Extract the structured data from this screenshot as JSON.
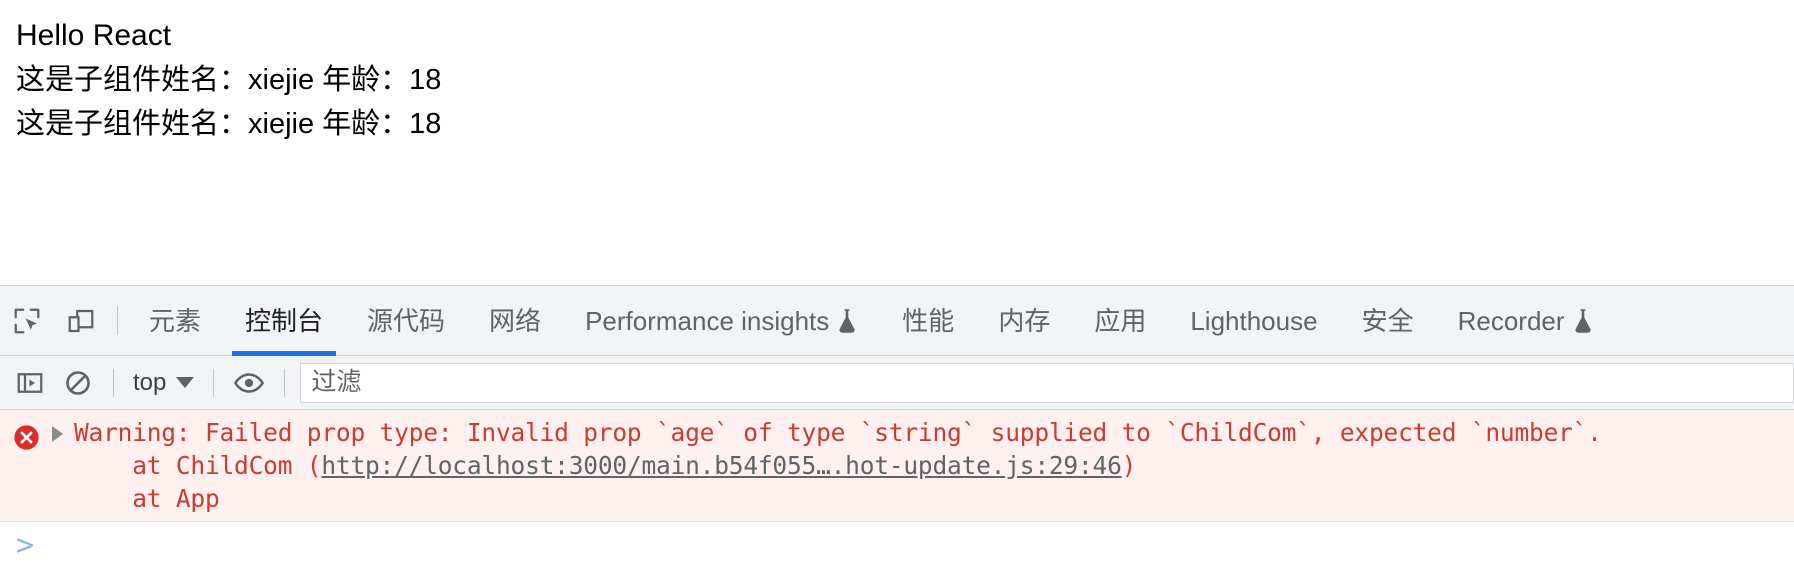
{
  "page": {
    "lines": [
      "Hello React",
      "这是子组件姓名：xiejie 年龄：18",
      "这是子组件姓名：xiejie 年龄：18"
    ]
  },
  "devtools": {
    "toolbar_icons": {
      "inspect": "inspect-element-icon",
      "device": "device-toolbar-icon"
    },
    "tabs": [
      {
        "label": "元素",
        "active": false,
        "experimental": false
      },
      {
        "label": "控制台",
        "active": true,
        "experimental": false
      },
      {
        "label": "源代码",
        "active": false,
        "experimental": false
      },
      {
        "label": "网络",
        "active": false,
        "experimental": false
      },
      {
        "label": "Performance insights",
        "active": false,
        "experimental": true
      },
      {
        "label": "性能",
        "active": false,
        "experimental": false
      },
      {
        "label": "内存",
        "active": false,
        "experimental": false
      },
      {
        "label": "应用",
        "active": false,
        "experimental": false
      },
      {
        "label": "Lighthouse",
        "active": false,
        "experimental": false
      },
      {
        "label": "安全",
        "active": false,
        "experimental": false
      },
      {
        "label": "Recorder",
        "active": false,
        "experimental": true
      }
    ],
    "active_tab_color": "#1a73e8",
    "console_toolbar": {
      "sidebar_toggle": "console-sidebar-icon",
      "clear_console": "clear-console-icon",
      "context_selector": "top",
      "eye_icon": "live-expression-icon",
      "filter_placeholder": "过滤"
    },
    "console": {
      "messages": [
        {
          "level": "error",
          "icon": "error-circle-icon",
          "expanded": false,
          "lines": [
            {
              "segments": [
                {
                  "text": "Warning: Failed prop type: Invalid prop `age` of type `string` supplied to `ChildCom`, expected `number`.",
                  "kind": "text"
                }
              ]
            },
            {
              "segments": [
                {
                  "text": "    at ChildCom (",
                  "kind": "text"
                },
                {
                  "text": "http://localhost:3000/main.b54f055….hot-update.js:29:46",
                  "kind": "link"
                },
                {
                  "text": ")",
                  "kind": "text"
                }
              ]
            },
            {
              "segments": [
                {
                  "text": "    at App",
                  "kind": "text"
                }
              ]
            }
          ]
        }
      ],
      "prompt_symbol": ">",
      "error_color": "#cf3b33",
      "error_background": "#fdf0ef"
    }
  }
}
